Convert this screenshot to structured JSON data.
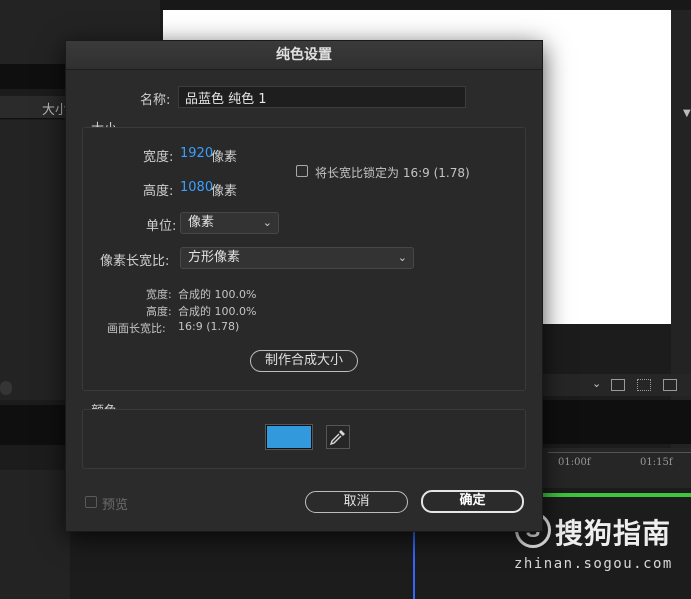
{
  "background": {
    "panel_label": "大小",
    "timeline_ticks": [
      "01:00f",
      "01:15f"
    ],
    "watermark": {
      "brand": "搜狗指南",
      "logo_letter": "S",
      "url": "zhinan.sogou.com"
    }
  },
  "dialog": {
    "title": "纯色设置",
    "name_label": "名称:",
    "name_value": "品蓝色 纯色 1",
    "size_group": {
      "title": "大小",
      "width_label": "宽度:",
      "width_value": "1920",
      "width_unit": "像素",
      "height_label": "高度:",
      "height_value": "1080",
      "height_unit": "像素",
      "lock_aspect_label": "将长宽比锁定为 16:9 (1.78)",
      "lock_aspect_checked": false,
      "units_label": "单位:",
      "units_value": "像素",
      "pixel_aspect_label": "像素长宽比:",
      "pixel_aspect_value": "方形像素",
      "info_width_label": "宽度:",
      "info_width_value": "合成的 100.0%",
      "info_height_label": "高度:",
      "info_height_value": "合成的 100.0%",
      "info_frame_label": "画面长宽比:",
      "info_frame_value": "16:9 (1.78)",
      "make_comp_size_button": "制作合成大小"
    },
    "color_group": {
      "title": "颜色",
      "swatch_color": "#3399dd"
    },
    "preview_label": "预览",
    "preview_checked": false,
    "cancel_button": "取消",
    "ok_button": "确定"
  },
  "colors": {
    "accent_value": "#3aa0ff",
    "dialog_bg": "#2b2b2b",
    "timeline_green": "#3fc43f"
  }
}
